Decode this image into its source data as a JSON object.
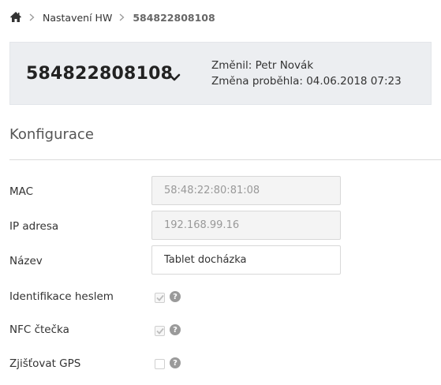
{
  "breadcrumb": {
    "home_icon": "home-icon",
    "items": [
      "Nastavení HW",
      "584822808108"
    ]
  },
  "device": {
    "id": "584822808108",
    "changed_by": "Změnil: Petr Novák",
    "changed_at": "Změna proběhla: 04.06.2018 07:23"
  },
  "section": {
    "title": "Konfigurace"
  },
  "form": {
    "mac": {
      "label": "MAC",
      "value": "58:48:22:80:81:08",
      "readonly": true
    },
    "ip": {
      "label": "IP adresa",
      "value": "192.168.99.16",
      "readonly": true
    },
    "name": {
      "label": "Název",
      "value": "Tablet docházka",
      "readonly": false
    },
    "password_ident": {
      "label": "Identifikace heslem",
      "checked": true,
      "disabled": true
    },
    "nfc": {
      "label": "NFC čtečka",
      "checked": true,
      "disabled": true
    },
    "gps": {
      "label": "Zjišťovat GPS",
      "checked": false,
      "disabled": false
    }
  },
  "help_icon_glyph": "?",
  "colors": {
    "header_bg": "#eceef1",
    "help_icon": "#9a9a9a"
  }
}
